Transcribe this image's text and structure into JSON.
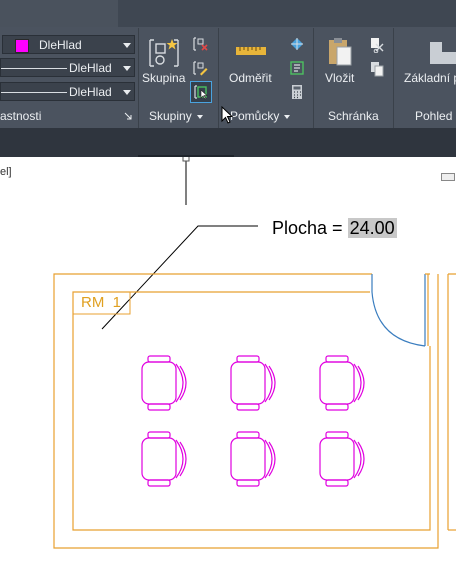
{
  "ribbon": {
    "properties": {
      "color_dropdown": {
        "value": "DleHlad",
        "swatch": "#ff00ff"
      },
      "linetype_dropdown": {
        "value": "DleHlad"
      },
      "lineweight_dropdown": {
        "value": "DleHlad"
      },
      "panel_label": "astnosti"
    },
    "groups": {
      "button_label": "Skupina",
      "panel_label": "Skupiny"
    },
    "utilities": {
      "button_label": "Odměřit",
      "panel_label": "Pomůcky"
    },
    "clipboard": {
      "button_label": "Vložit",
      "panel_label": "Schránka"
    },
    "view": {
      "button_label": "Základní p",
      "panel_label": "Pohled"
    },
    "colors": {
      "background": "#4b535f",
      "dark_strip": "#2f353e",
      "text": "#eceff2",
      "icon_blue": "#4aa3df"
    }
  },
  "viewport": {
    "view_control": "el]",
    "annotation": {
      "label": "Plocha = ",
      "value": "24.00"
    },
    "room_tag": "RM  1",
    "colors": {
      "walls": "#e8a030",
      "furniture": "#e000e0",
      "door": "#3a7dbf"
    }
  }
}
